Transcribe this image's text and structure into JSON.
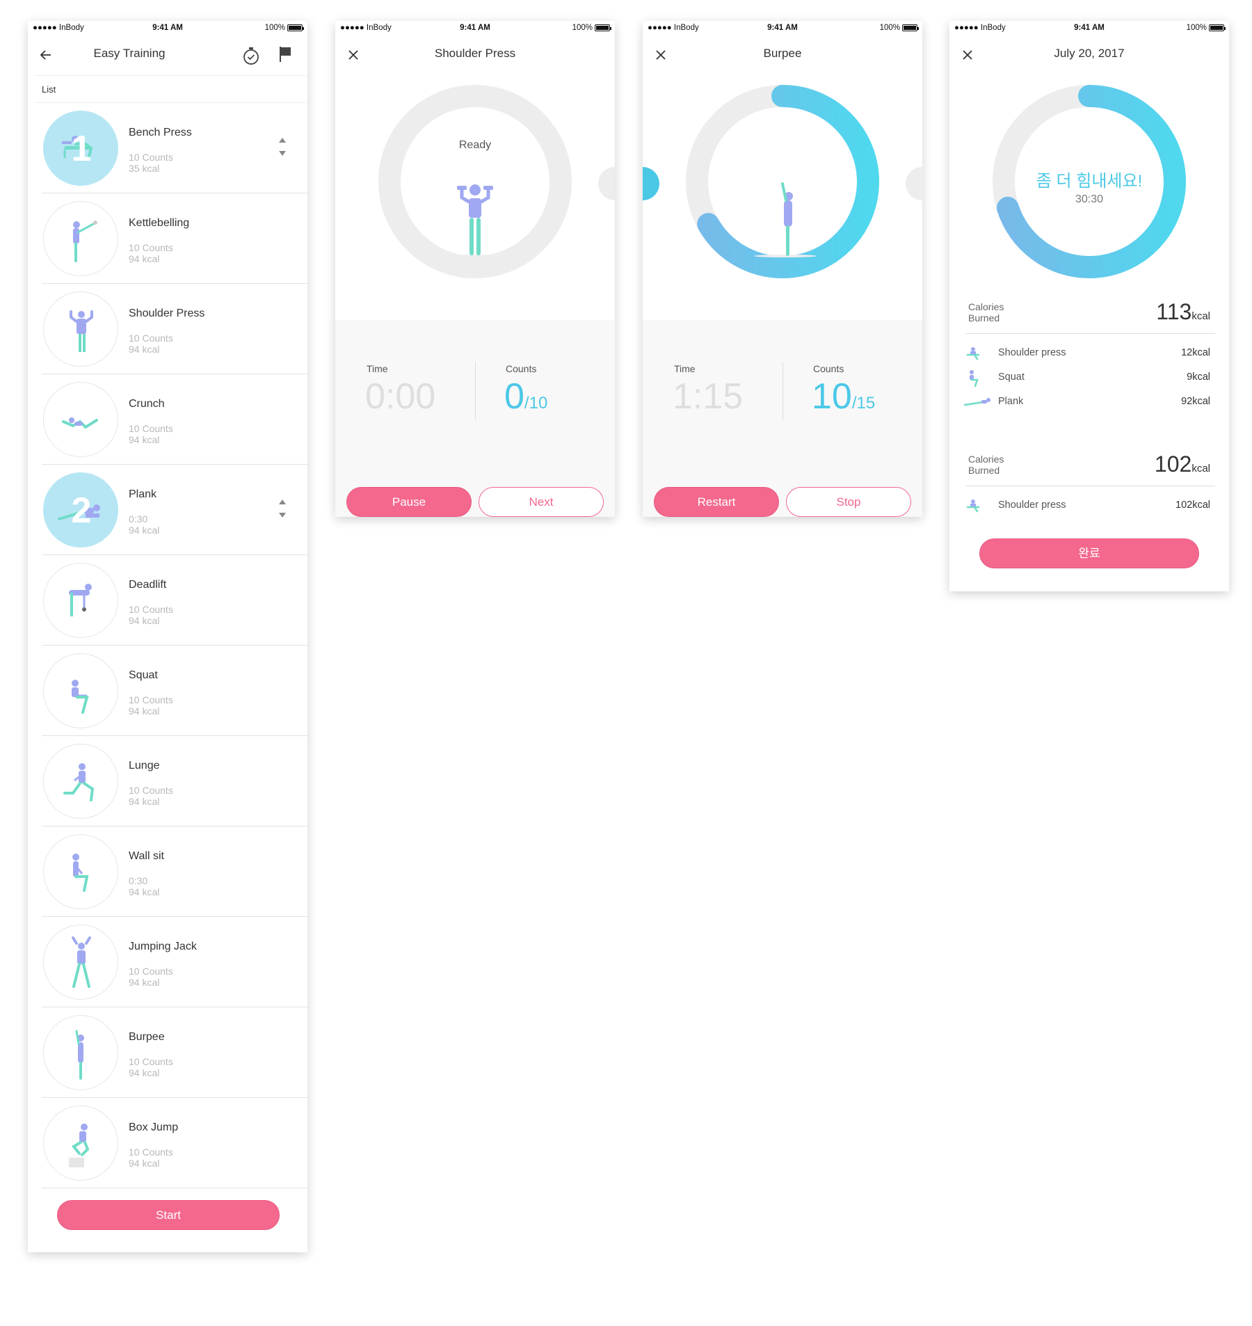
{
  "colors": {
    "accent_pink": "#f4688e",
    "accent_cyan": "#4bc8e6",
    "figure_purple": "#9fa8f0",
    "figure_teal": "#6fdcc7"
  },
  "status_bar": {
    "carrier": "●●●●● InBody",
    "time": "9:41 AM",
    "battery": "100%"
  },
  "list_screen": {
    "title": "Easy Training",
    "back_icon": "arrow-left-icon",
    "timer_icon": "stopwatch-icon",
    "flag_icon": "flag-icon",
    "section_label": "List",
    "items": [
      {
        "name": "Bench Press",
        "line1": "10 Counts",
        "line2": "35 kcal",
        "order": "1",
        "selected": true
      },
      {
        "name": "Kettlebelling",
        "line1": "10 Counts",
        "line2": "94 kcal"
      },
      {
        "name": "Shoulder Press",
        "line1": "10 Counts",
        "line2": "94 kcal"
      },
      {
        "name": "Crunch",
        "line1": "10 Counts",
        "line2": "94 kcal"
      },
      {
        "name": "Plank",
        "line1": "0:30",
        "line2": "94 kcal",
        "order": "2",
        "selected": true
      },
      {
        "name": "Deadlift",
        "line1": "10 Counts",
        "line2": "94 kcal"
      },
      {
        "name": "Squat",
        "line1": "10 Counts",
        "line2": "94 kcal"
      },
      {
        "name": "Lunge",
        "line1": "10 Counts",
        "line2": "94 kcal"
      },
      {
        "name": "Wall sit",
        "line1": "0:30",
        "line2": "94 kcal"
      },
      {
        "name": "Jumping Jack",
        "line1": "10 Counts",
        "line2": "94 kcal"
      },
      {
        "name": "Burpee",
        "line1": "10 Counts",
        "line2": "94 kcal"
      },
      {
        "name": "Box Jump",
        "line1": "10 Counts",
        "line2": "94 kcal"
      }
    ],
    "start_button": "Start"
  },
  "shoulder_screen": {
    "title": "Shoulder Press",
    "ring_status": "Ready",
    "progress": 0,
    "time_label": "Time",
    "time_value": "0:00",
    "counts_label": "Counts",
    "count_value": "0",
    "count_total": "/10",
    "pause_button": "Pause",
    "next_button": "Next"
  },
  "burpee_screen": {
    "title": "Burpee",
    "progress": 0.667,
    "time_label": "Time",
    "time_value": "1:15",
    "counts_label": "Counts",
    "count_value": "10",
    "count_total": "/15",
    "restart_button": "Restart",
    "stop_button": "Stop"
  },
  "summary_screen": {
    "title": "July 20, 2017",
    "progress": 0.7,
    "ring_message": "좀 더 힘내세요!",
    "ring_time": "30:30",
    "group1": {
      "label": "Calories Burned",
      "value": "113",
      "unit": "kcal",
      "items": [
        {
          "name": "Shoulder press",
          "kcal": "12kcal"
        },
        {
          "name": "Squat",
          "kcal": "9kcal"
        },
        {
          "name": "Plank",
          "kcal": "92kcal"
        }
      ]
    },
    "group2": {
      "label": "Calories Burned",
      "value": "102",
      "unit": "kcal",
      "items": [
        {
          "name": "Shoulder press",
          "kcal": "102kcal"
        }
      ]
    },
    "done_button": "완료"
  }
}
